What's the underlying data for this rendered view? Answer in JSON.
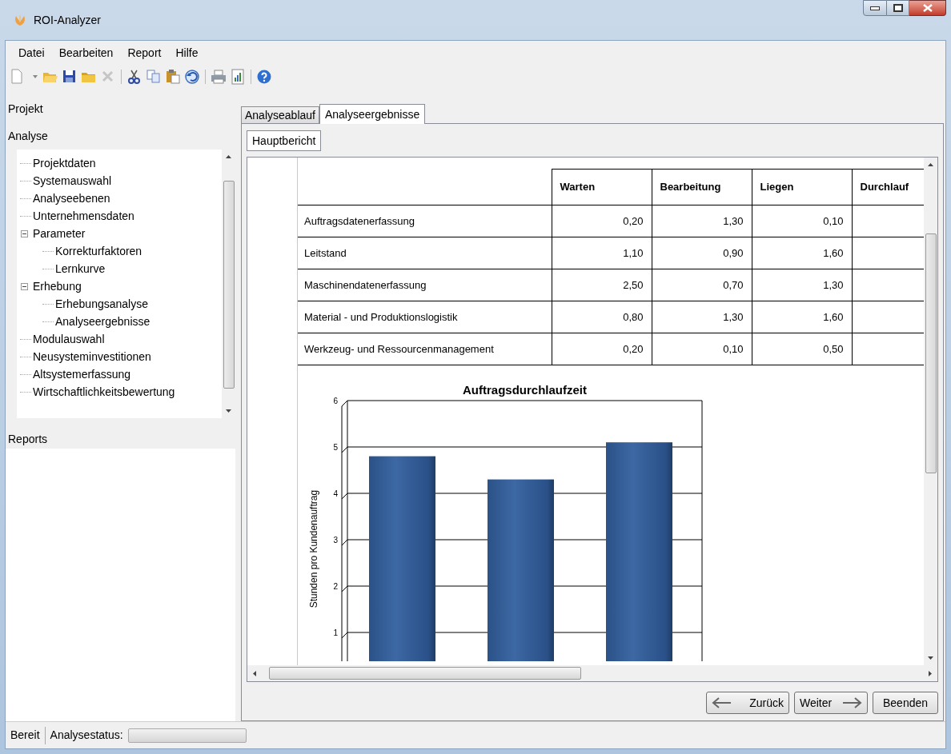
{
  "window": {
    "title": "ROI-Analyzer"
  },
  "menu": [
    "Datei",
    "Bearbeiten",
    "Report",
    "Hilfe"
  ],
  "toolbar": [
    {
      "kind": "new",
      "disabled": false
    },
    {
      "kind": "dropdown",
      "disabled": false
    },
    {
      "kind": "open",
      "disabled": false
    },
    {
      "kind": "save",
      "disabled": false
    },
    {
      "kind": "folder",
      "disabled": false
    },
    {
      "kind": "delete",
      "disabled": true
    },
    {
      "kind": "separator"
    },
    {
      "kind": "cut",
      "disabled": false
    },
    {
      "kind": "copy",
      "disabled": false
    },
    {
      "kind": "paste",
      "disabled": false
    },
    {
      "kind": "undo",
      "disabled": false
    },
    {
      "kind": "separator"
    },
    {
      "kind": "print",
      "disabled": false
    },
    {
      "kind": "report",
      "disabled": false
    },
    {
      "kind": "separator"
    },
    {
      "kind": "help",
      "disabled": false
    }
  ],
  "sidebar": {
    "sections": [
      "Projekt",
      "Analyse"
    ],
    "tree": [
      {
        "label": "Projektdaten"
      },
      {
        "label": "Systemauswahl"
      },
      {
        "label": "Analyseebenen"
      },
      {
        "label": "Unternehmensdaten"
      },
      {
        "label": "Parameter",
        "expanded": true,
        "children": [
          {
            "label": "Korrekturfaktoren"
          },
          {
            "label": "Lernkurve"
          }
        ]
      },
      {
        "label": "Erhebung",
        "expanded": true,
        "children": [
          {
            "label": "Erhebungsanalyse"
          },
          {
            "label": "Analyseergebnisse"
          }
        ]
      },
      {
        "label": "Modulauswahl"
      },
      {
        "label": "Neusysteminvestitionen"
      },
      {
        "label": "Altsystemerfassung"
      },
      {
        "label": "Wirtschaftlichkeitsbewertung"
      }
    ],
    "reports_header": "Reports"
  },
  "tabs": [
    {
      "label": "Analyseablauf",
      "selected": false
    },
    {
      "label": "Analyseergebnisse",
      "selected": true
    }
  ],
  "subtabs": [
    {
      "label": "Hauptbericht",
      "selected": true
    }
  ],
  "table": {
    "columns": [
      "Warten",
      "Bearbeitung",
      "Liegen",
      "Durchlauf"
    ],
    "rows": [
      {
        "name": "Auftragsdatenerfassung",
        "values": [
          "0,20",
          "1,30",
          "0,10"
        ]
      },
      {
        "name": "Leitstand",
        "values": [
          "1,10",
          "0,90",
          "1,60"
        ]
      },
      {
        "name": "Maschinendatenerfassung",
        "values": [
          "2,50",
          "0,70",
          "1,30"
        ]
      },
      {
        "name": "Material - und Produktionslogistik",
        "values": [
          "0,80",
          "1,30",
          "1,60"
        ]
      },
      {
        "name": "Werkzeug- und Ressourcenmanagement",
        "values": [
          "0,20",
          "0,10",
          "0,50"
        ]
      }
    ]
  },
  "chart_data": {
    "type": "bar",
    "title": "Auftragsdurchlaufzeit",
    "ylabel": "Stunden pro Kundenauftrag",
    "values": [
      4.8,
      4.3,
      5.1
    ],
    "ylim": [
      0,
      6
    ],
    "grid": true,
    "yticks": [
      1,
      2,
      3,
      4,
      5,
      6
    ]
  },
  "buttons": [
    {
      "kind": "back",
      "label": "Zurück"
    },
    {
      "kind": "next",
      "label": "Weiter"
    },
    {
      "kind": "plain",
      "label": "Beenden"
    }
  ],
  "status_bar": {
    "state": "Bereit",
    "label": "Analysestatus:",
    "level": 0
  }
}
